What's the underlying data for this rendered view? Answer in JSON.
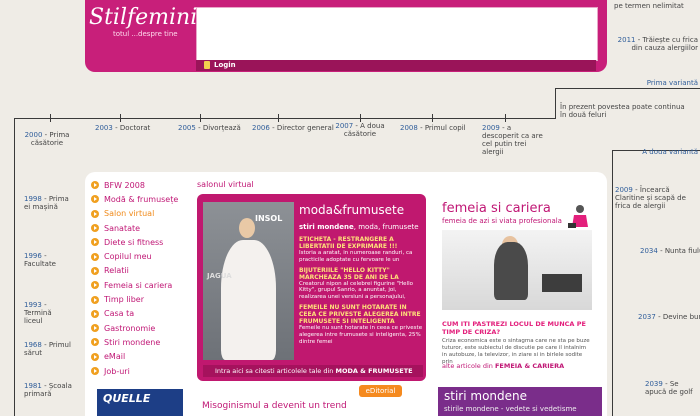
{
  "header": {
    "logo": "Stilfeminin",
    "tagline": "totul ...despre tine",
    "login_label": "Login"
  },
  "timeline": {
    "right_top": [
      {
        "text": "pe termen nelimitat"
      },
      {
        "year": "2011",
        "text": "- Trăiește cu frica din cauza alergiilor"
      },
      {
        "year": "",
        "text": "Prima variantă"
      },
      {
        "year": "",
        "text": "În prezent povestea poate continua în două feluri"
      }
    ],
    "middle": [
      {
        "year": "2003",
        "text": "- Doctorat"
      },
      {
        "year": "2005",
        "text": "- Divorțează"
      },
      {
        "year": "2006",
        "text": "- Director general"
      },
      {
        "year": "2007",
        "text": "- A doua căsătorie"
      },
      {
        "year": "2008",
        "text": "- Primul copil"
      },
      {
        "year": "2009",
        "text": "- a descoperit ca are cel putin trei alergii"
      }
    ],
    "left": [
      {
        "year": "2000",
        "text": "- Prima căsătorie"
      },
      {
        "year": "1998",
        "text": "- Prima ei mașină"
      },
      {
        "year": "1996",
        "text": "- Facultate"
      },
      {
        "year": "1993",
        "text": "- Termină liceul"
      },
      {
        "year": "1968",
        "text": "- Primul sărut"
      },
      {
        "year": "1981",
        "text": "- Școala primară"
      }
    ],
    "right": [
      {
        "year": "",
        "text": "A doua variantă"
      },
      {
        "year": "2009",
        "text": "- Încearcă Claritine și scapă de frica de alergii"
      },
      {
        "year": "2034",
        "text": "- Nunta fiului ei"
      },
      {
        "year": "2037",
        "text": "- Devine bunică"
      },
      {
        "year": "2039",
        "text": "- Se apucă de golf"
      }
    ]
  },
  "sidebar": {
    "items": [
      {
        "label": "BFW 2008"
      },
      {
        "label": "Modă & frumusețe"
      },
      {
        "label": "Salon virtual"
      },
      {
        "label": "Sanatate"
      },
      {
        "label": "Diete si fitness"
      },
      {
        "label": "Copilul meu"
      },
      {
        "label": "Relatii"
      },
      {
        "label": "Femeia si cariera"
      },
      {
        "label": "Timp liber"
      },
      {
        "label": "Casa ta"
      },
      {
        "label": "Gastronomie"
      },
      {
        "label": "Stiri mondene"
      },
      {
        "label": "eMail"
      },
      {
        "label": "Job-uri"
      }
    ],
    "ad_label": "QUELLE"
  },
  "salon": {
    "title": "salonul virtual"
  },
  "moda": {
    "heading": "moda&frumusete",
    "sub_bold": "stiri mondene",
    "sub_rest": ", moda, frumusete",
    "photo_text_1": "INSOL",
    "photo_text_2": "JAGUA",
    "stories": [
      {
        "headline": "ETICHETA - RESTRANGERE A LIBERTATII DE EXPRIMARE !!!",
        "text": "Istoria a aratat, in numeroase randuri, ca practicile adoptate cu fervoare le un"
      },
      {
        "headline": "BIJUTERIILE \"HELLO KITTY\" MARCHEAZA 35 DE ANI DE LA",
        "text": "Creatorul nipon al celebrei figurine \"Hello Kitty\", grupul Sanrio, a anuntat, joi, realizarea unei versiuni a personajului,"
      },
      {
        "headline": "FEMEILE NU SUNT HOTARATE IN CEEA CE PRIVESTE ALEGEREA INTRE FRUMUSETE SI INTELIGENTA",
        "text": "Femeile nu sunt hotarate in ceea ce priveste alegerea intre frumusete si inteligenta, 25% dintre femei"
      }
    ],
    "footer_text": "Intra aici sa citesti articolele tale din",
    "footer_bold": "MODA & FRUMUSETE"
  },
  "femeia": {
    "heading": "femeia si cariera",
    "sub": "femeia de azi si viata profesionala",
    "question": "CUM ITI PASTREZI LOCUL DE MUNCA PE TIMP DE CRIZA?",
    "text": "Criza economica este o sintagma care ne sta pe buze tuturor, este subiectul de discutie pe care il intalnim in autobuze, la televizor, in ziare si in birlele sodite prin",
    "link_text": "alte articole din",
    "link_bold": "FEMEIA & CARIERA"
  },
  "bottom": {
    "article_title": "Misoginismul a devenit un trend",
    "editorial_label": "eDitorial",
    "stiri_heading": "stiri mondene",
    "stiri_sub": "stirile mondene - vedete si vedetisme"
  }
}
